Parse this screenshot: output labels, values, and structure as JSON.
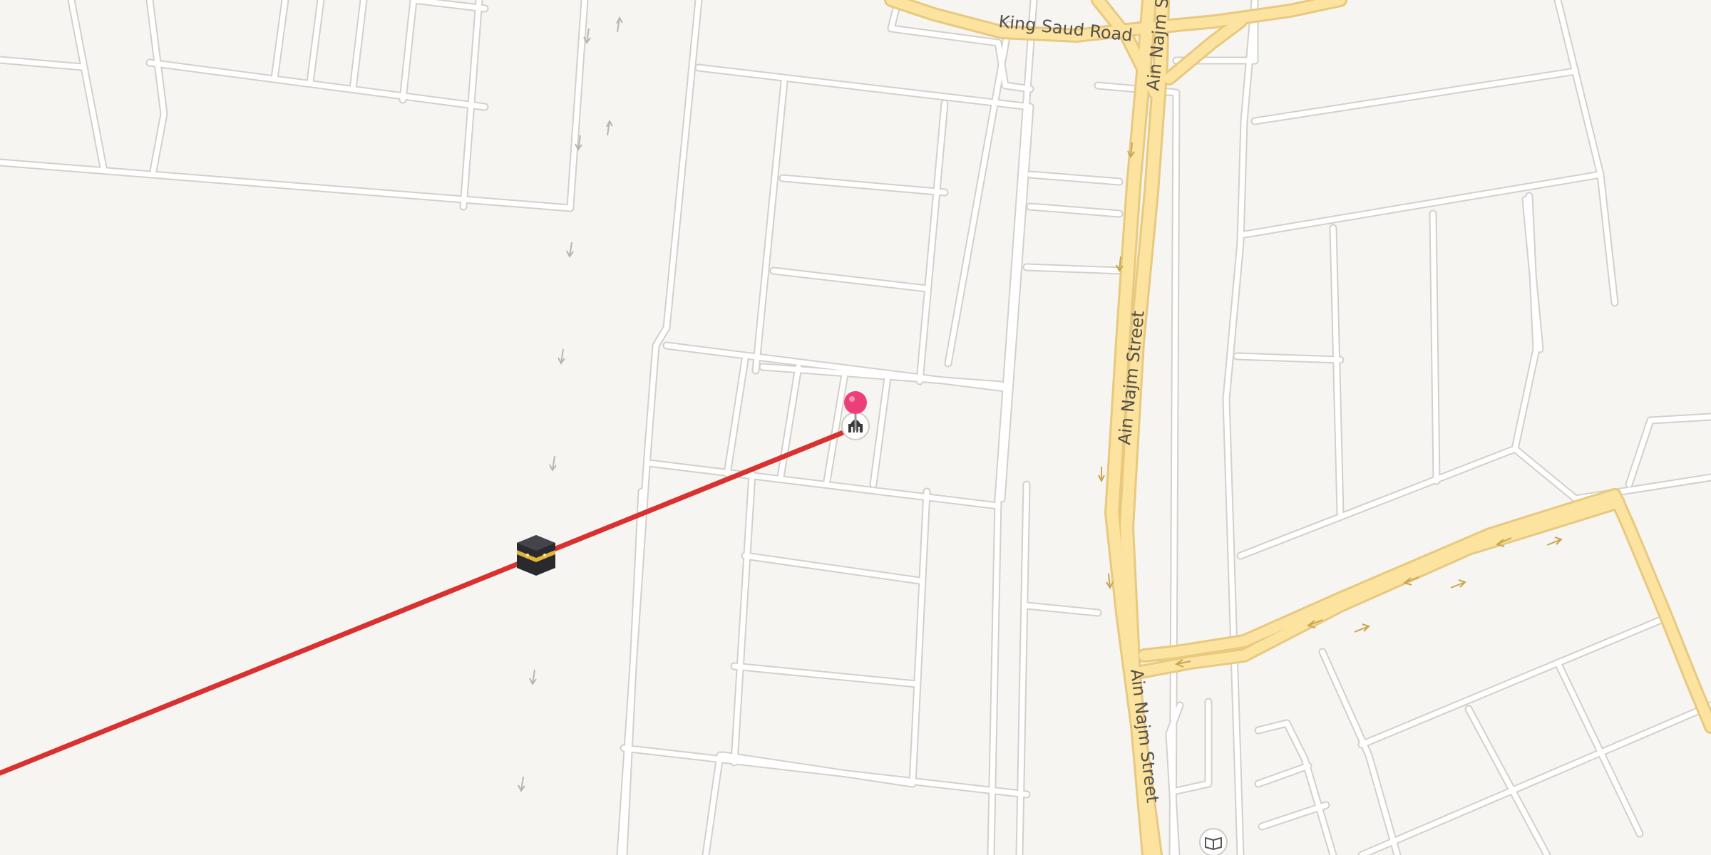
{
  "map": {
    "colors": {
      "background": "#f7f5f2",
      "minor_road": "#ffffff",
      "minor_road_casing": "#d3d0ca",
      "major_road": "#fde3a0",
      "major_road_casing": "#e7c97f",
      "qibla_line": "#d8312f",
      "pin": "#ee3e7a"
    },
    "street_labels": {
      "king_saud": "King Saud Road",
      "ain_najm_top": "Ain Najm S",
      "ain_najm_mid": "Ain Najm Street",
      "ain_najm_bottom": "Ain Najm Street"
    },
    "markers": {
      "kaaba": "kaaba-icon",
      "mosque": "mosque-icon",
      "pin": "location-pin-icon",
      "library": "book-icon"
    }
  }
}
